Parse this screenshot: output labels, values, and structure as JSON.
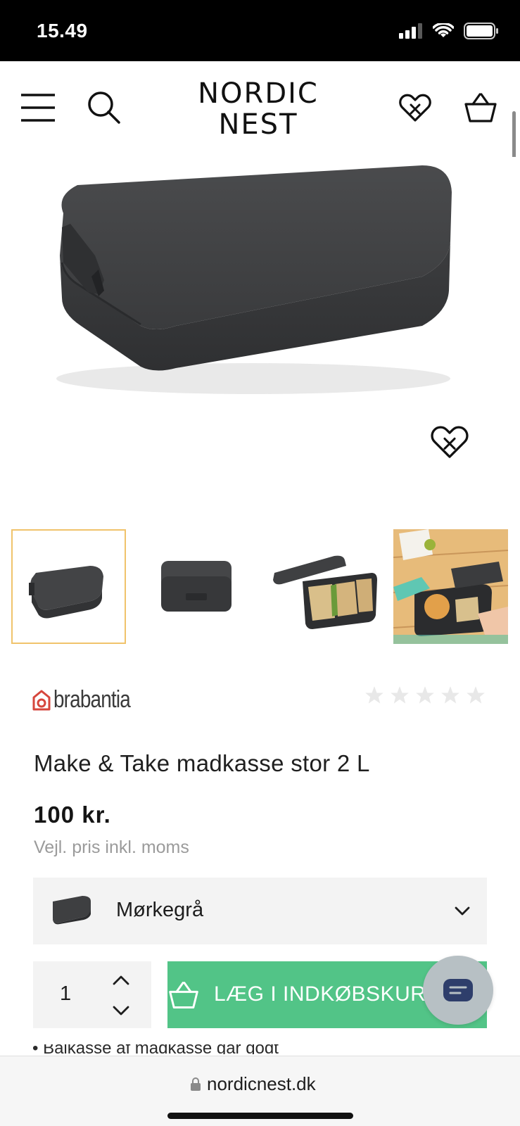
{
  "status_bar": {
    "time": "15.49"
  },
  "header": {
    "logo_line1": "NORDIC",
    "logo_line2": "NEST"
  },
  "product": {
    "brand": "brabantia",
    "rating": 0,
    "rating_max": 5,
    "title": "Make & Take madkasse stor 2 L",
    "price": "100 kr.",
    "price_note": "Vejl. pris inkl. moms"
  },
  "thumbnails": [
    {
      "alt": "lunchbox-front"
    },
    {
      "alt": "lunchbox-side"
    },
    {
      "alt": "lunchbox-open-sandwiches"
    },
    {
      "alt": "lunchbox-lifestyle"
    }
  ],
  "variant": {
    "selected": "Mørkegrå"
  },
  "quantity": {
    "value": "1"
  },
  "cart": {
    "add_label": "LÆG I INDKØBSKURV"
  },
  "partial_text": "• Bålkasse af madkasse går godt",
  "browser": {
    "url": "nordicnest.dk"
  },
  "colors": {
    "accent_green": "#52c487",
    "thumb_active_border": "#f0c36b",
    "brand_red": "#d6463c",
    "product_dark": "#3e3f41"
  },
  "icons": [
    "menu-icon",
    "search-icon",
    "heart-icon",
    "basket-icon",
    "wifi-icon",
    "battery-icon",
    "signal-icon",
    "star-icon",
    "chevron-down-icon",
    "chevron-up-icon",
    "chat-icon",
    "lock-icon"
  ]
}
